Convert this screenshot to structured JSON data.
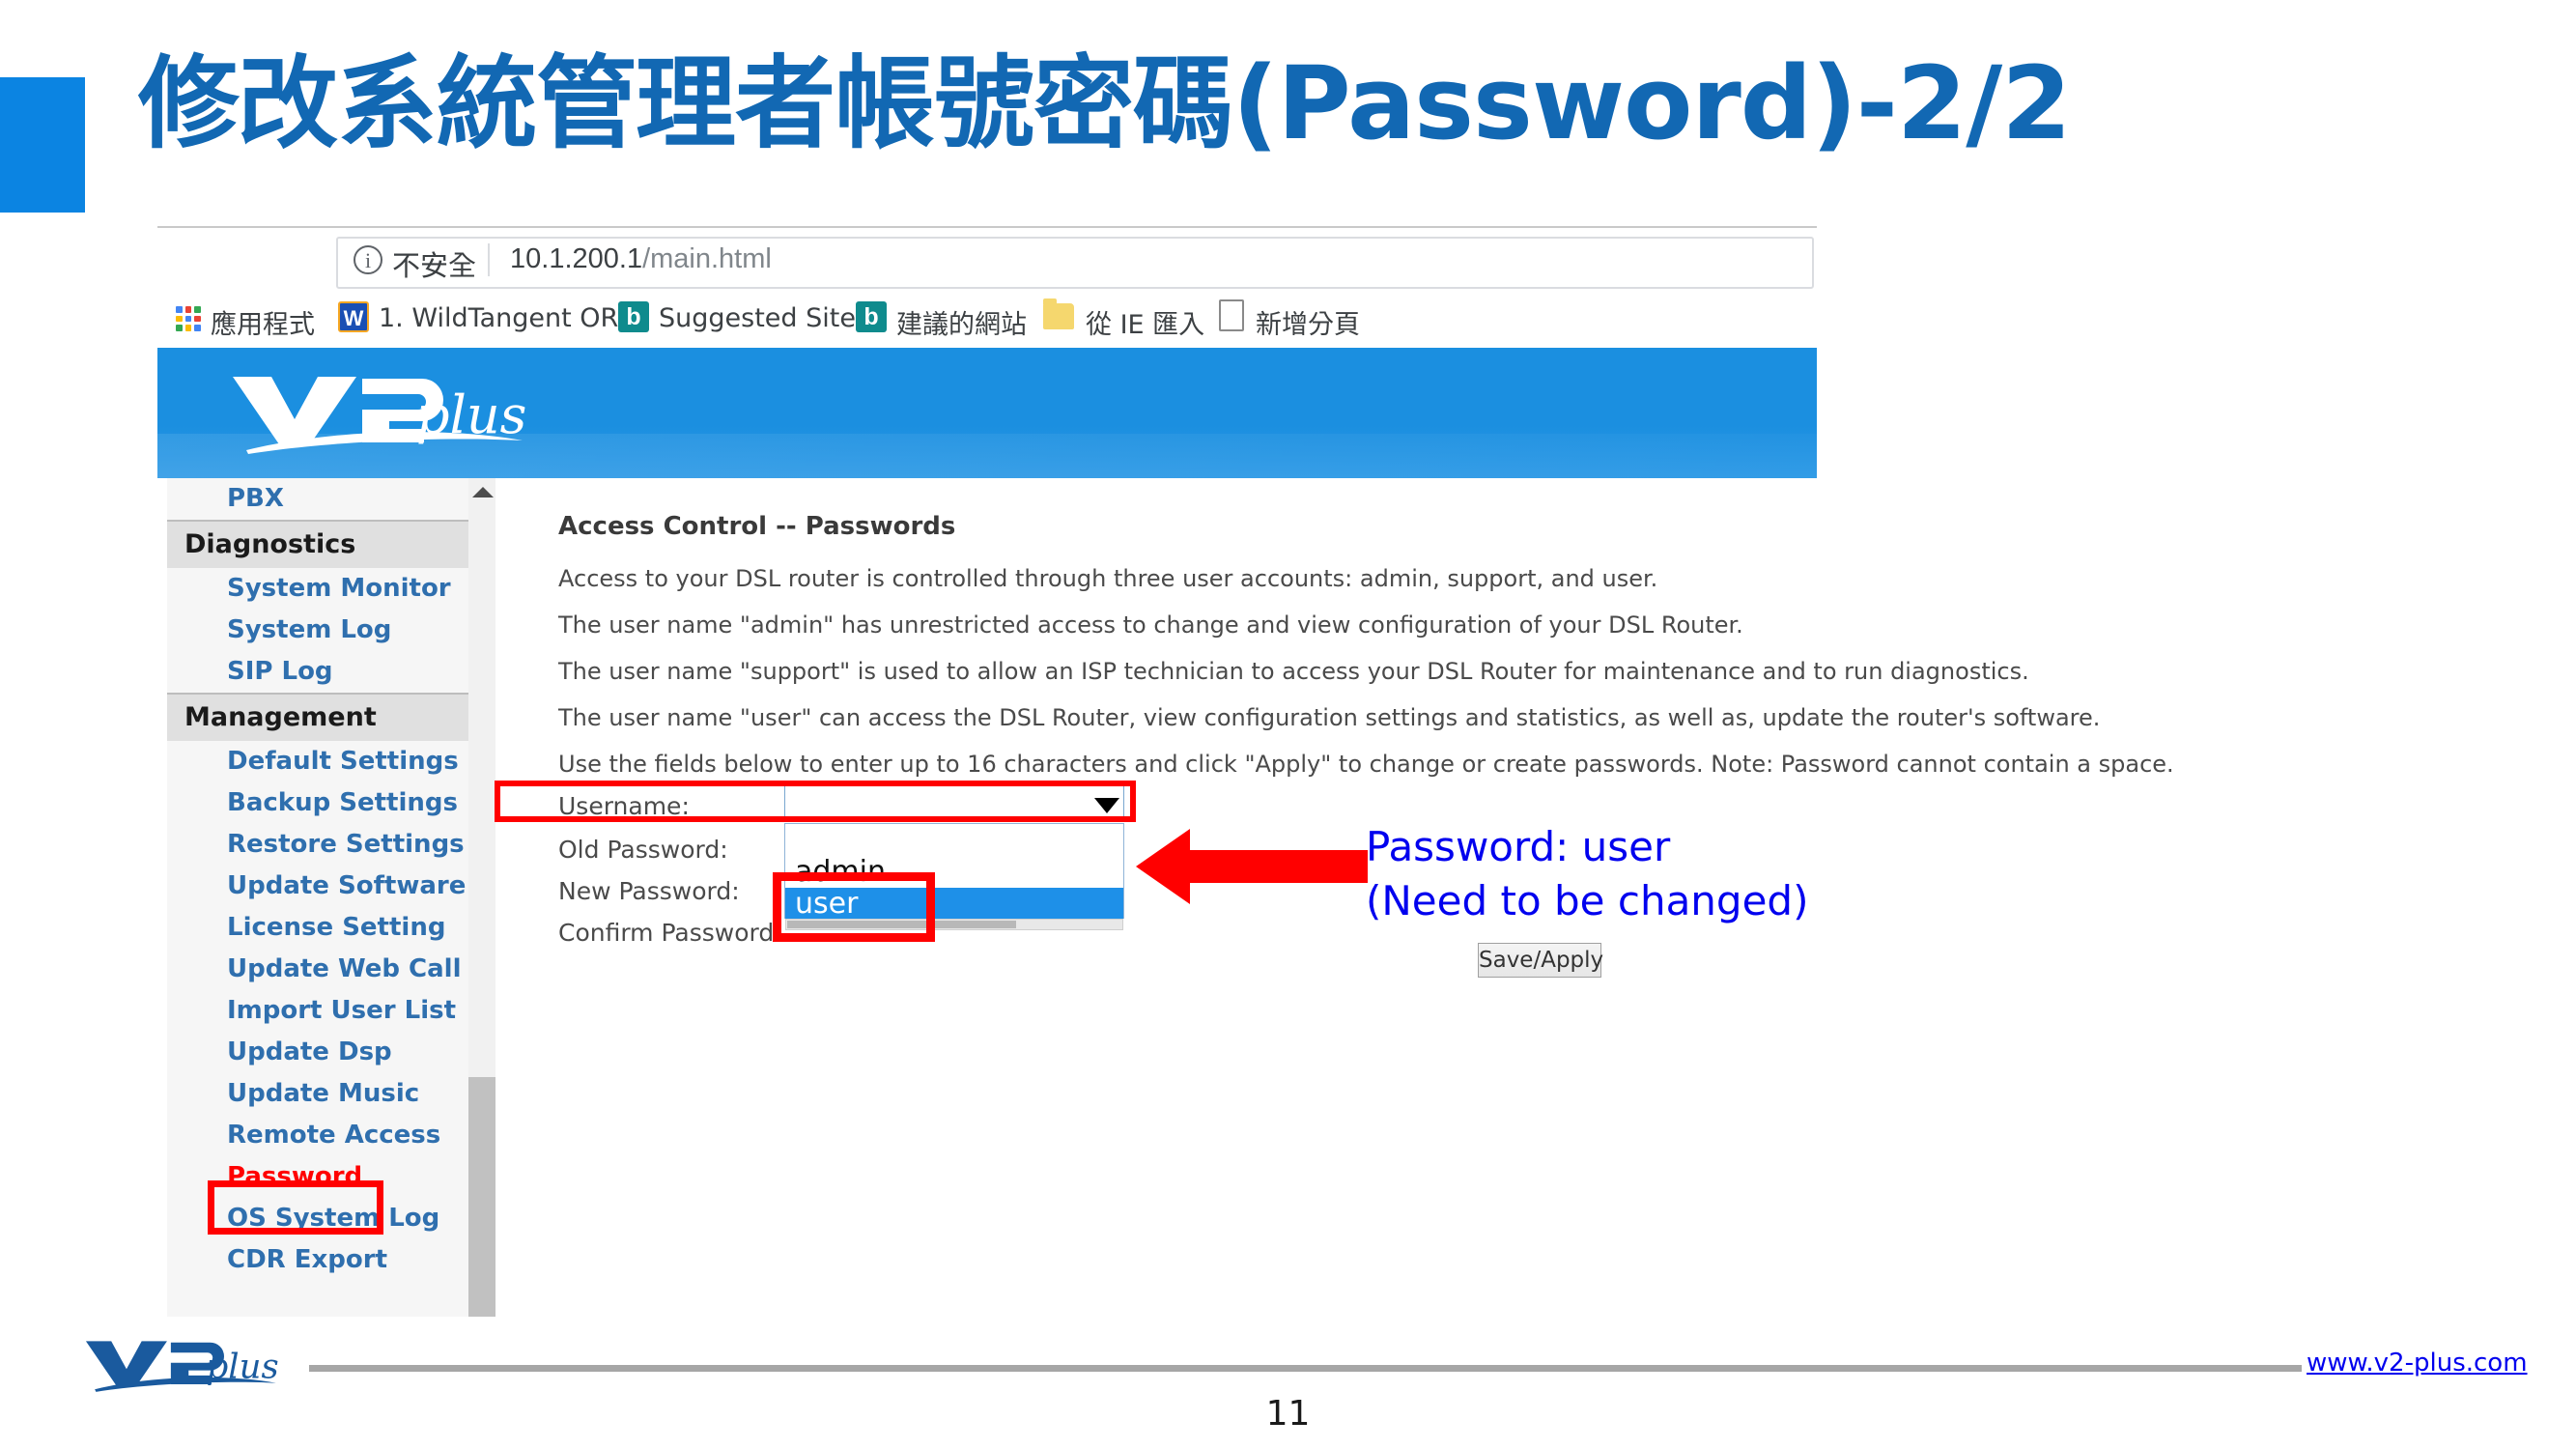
{
  "slide": {
    "title": "修改系統管理者帳號密碼(Password)-2/2",
    "page_number": "11",
    "accent_color": "#0b84e2",
    "title_color": "#1268b3"
  },
  "browser": {
    "nav": {
      "back_icon": "arrow-left-icon",
      "forward_icon": "arrow-right-icon",
      "reload_icon": "reload-icon",
      "back_glyph": "←",
      "forward_glyph": "→",
      "reload_glyph": "⟳"
    },
    "omnibox": {
      "security_icon": "info-circle-icon",
      "security_glyph": "i",
      "security_text": "不安全",
      "url_host": "10.1.200.1",
      "url_path": "/main.html"
    },
    "bookmarks": [
      {
        "label": "應用程式",
        "icon": "apps-grid-icon"
      },
      {
        "label": "1. WildTangent ORB",
        "icon": "wildtangent-icon",
        "icon_glyph": "W"
      },
      {
        "label": "Suggested Sites",
        "icon": "bing-icon",
        "icon_glyph": "b"
      },
      {
        "label": "建議的網站",
        "icon": "bing-icon",
        "icon_glyph": "b"
      },
      {
        "label": "從 IE 匯入",
        "icon": "folder-icon"
      },
      {
        "label": "新增分頁",
        "icon": "page-icon"
      }
    ]
  },
  "banner": {
    "logo_name": "v2plus-logo",
    "logo_text": "V2plus",
    "background_color": "#1b8fe0"
  },
  "sidebar": {
    "items": [
      {
        "label": "PBX",
        "type": "link",
        "active": false
      },
      {
        "label": "Diagnostics",
        "type": "header"
      },
      {
        "label": "System Monitor",
        "type": "link",
        "active": false
      },
      {
        "label": "System Log",
        "type": "link",
        "active": false
      },
      {
        "label": "SIP Log",
        "type": "link",
        "active": false
      },
      {
        "label": "Management",
        "type": "header"
      },
      {
        "label": "Default Settings",
        "type": "link",
        "active": false
      },
      {
        "label": "Backup Settings",
        "type": "link",
        "active": false
      },
      {
        "label": "Restore Settings",
        "type": "link",
        "active": false
      },
      {
        "label": "Update Software",
        "type": "link",
        "active": false
      },
      {
        "label": "License Setting",
        "type": "link",
        "active": false
      },
      {
        "label": "Update Web Call",
        "type": "link",
        "active": false
      },
      {
        "label": "Import User List",
        "type": "link",
        "active": false
      },
      {
        "label": "Update Dsp",
        "type": "link",
        "active": false
      },
      {
        "label": "Update Music",
        "type": "link",
        "active": false
      },
      {
        "label": "Remote Access",
        "type": "link",
        "active": false
      },
      {
        "label": "Password",
        "type": "link",
        "active": true
      },
      {
        "label": "OS System Log",
        "type": "link",
        "active": false
      },
      {
        "label": "CDR Export",
        "type": "link",
        "active": false
      }
    ],
    "link_color": "#2f6fae",
    "active_color": "#ff0000"
  },
  "main": {
    "title": "Access Control -- Passwords",
    "paragraphs": [
      "Access to your DSL router is controlled through three user accounts: admin, support, and user.",
      "The user name \"admin\" has unrestricted access to change and view configuration of your DSL Router.",
      "The user name \"support\" is used to allow an ISP technician to access your DSL Router for maintenance and to run diagnostics.",
      "The user name \"user\" can access the DSL Router, view configuration settings and statistics, as well as, update the router's software.",
      "Use the fields below to enter up to 16 characters and click \"Apply\" to change or create passwords. Note: Password cannot contain a space."
    ],
    "form": {
      "username_label": "Username:",
      "old_password_label": "Old Password:",
      "new_password_label": "New Password:",
      "confirm_password_label": "Confirm Password:",
      "username_value": "",
      "dropdown_open": true,
      "dropdown_options": [
        "",
        "admin",
        "user"
      ],
      "dropdown_selected": "user",
      "dropdown_highlight_color": "#1e90e8",
      "dropdown_arrow_icon": "chevron-down-icon"
    },
    "save_apply_label": "Save/Apply"
  },
  "annotations": {
    "callout_line1": "Password: user",
    "callout_line2": "(Need to be changed)",
    "callout_color": "#0000ee",
    "arrow_icon": "left-arrow-icon",
    "highlight_color": "#ff0000"
  },
  "footer": {
    "logo_name": "v2plus-logo-footer",
    "logo_text": "V2plus",
    "url": "www.v2-plus.com",
    "url_color": "#0000ee",
    "rule_color": "#a6a6a6"
  }
}
